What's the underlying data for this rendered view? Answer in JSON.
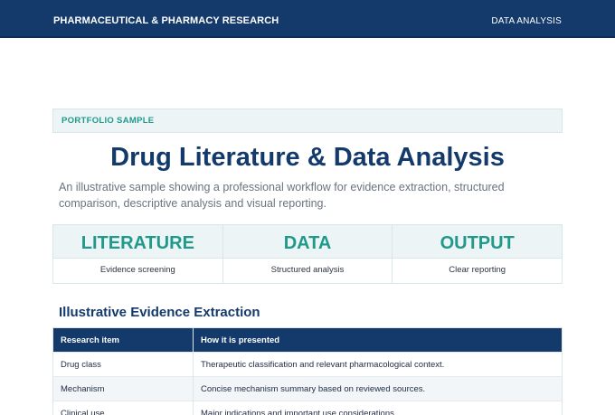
{
  "header": {
    "brand": "PHARMACEUTICAL & PHARMACY RESEARCH",
    "section": "DATA ANALYSIS"
  },
  "kicker": "PORTFOLIO SAMPLE",
  "title": "Drug Literature & Data Analysis",
  "subtitle": "An illustrative sample showing a professional workflow for evidence extraction, structured comparison, descriptive analysis and visual reporting.",
  "stats": [
    {
      "value": "LITERATURE",
      "label": "Evidence screening"
    },
    {
      "value": "DATA",
      "label": "Structured analysis"
    },
    {
      "value": "OUTPUT",
      "label": "Clear reporting"
    }
  ],
  "section_title": "Illustrative Evidence Extraction",
  "table": {
    "headers": [
      "Research item",
      "How it is presented"
    ],
    "rows": [
      [
        "Drug class",
        "Therapeutic classification and relevant pharmacological context."
      ],
      [
        "Mechanism",
        "Concise mechanism summary based on reviewed sources."
      ],
      [
        "Clinical use",
        "Major indications and important use considerations."
      ]
    ]
  },
  "colors": {
    "navy": "#143a6b",
    "teal": "#1f9a8a",
    "panel": "#edf4f6"
  }
}
